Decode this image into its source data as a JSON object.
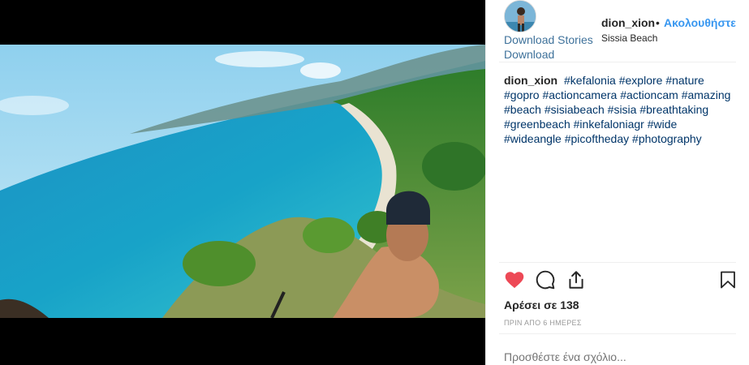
{
  "post": {
    "image_alt": "Selfie above Sissia Beach",
    "username": "dion_xion",
    "separator": "•",
    "follow_label": "Ακολουθήστε",
    "location": "Sissia Beach",
    "download_stories_label": "Download Stories",
    "download_label": "Download",
    "caption": {
      "username": "dion_xion",
      "hashtags": [
        "#kefalonia",
        "#explore",
        "#nature",
        "#gopro",
        "#actioncamera",
        "#actioncam",
        "#amazing",
        "#beach",
        "#sisiabeach",
        "#sisia",
        "#breathtaking",
        "#greenbeach",
        "#inkefaloniagr",
        "#wide",
        "#wideangle",
        "#picoftheday",
        "#photography"
      ]
    },
    "likes": "Αρέσει σε 138",
    "timestamp": "ΠΡΙΝ ΑΠΟ 6 ΗΜΕΡΕΣ",
    "comment_placeholder": "Προσθέστε ένα σχόλιο..."
  },
  "icons": {
    "like": "heart-icon",
    "comment": "comment-icon",
    "share": "share-icon",
    "save": "bookmark-icon"
  },
  "colors": {
    "link": "#3897f0",
    "download_link": "#3f729b",
    "hashtag": "#003569",
    "like_red": "#ed4956",
    "text": "#262626",
    "muted": "#999999"
  }
}
